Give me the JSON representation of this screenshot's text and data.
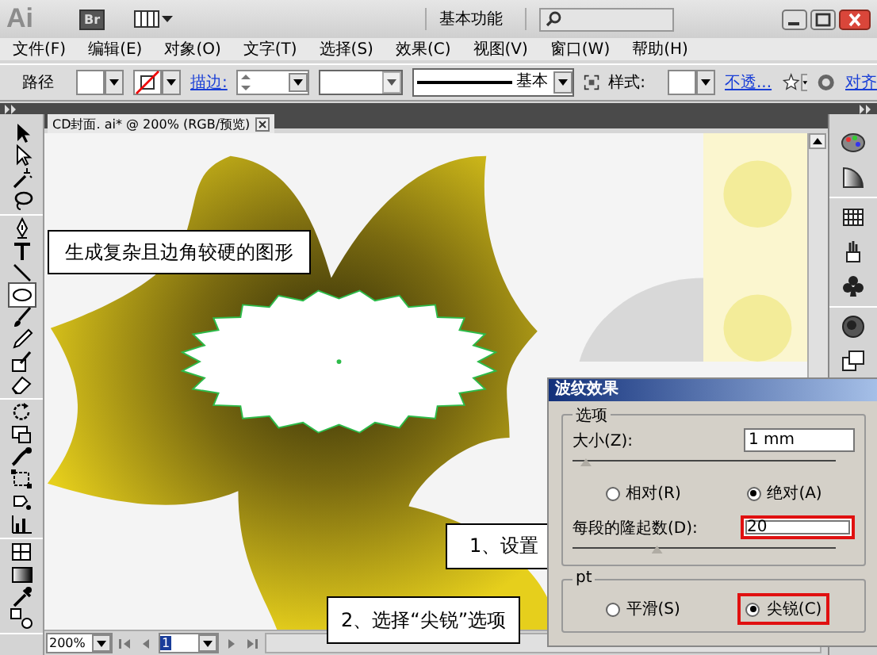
{
  "title_bar": {
    "logo": "Ai",
    "bridge": "Br",
    "workspace": "基本功能"
  },
  "menu": [
    {
      "label": "文件(F)"
    },
    {
      "label": "编辑(E)"
    },
    {
      "label": "对象(O)"
    },
    {
      "label": "文字(T)"
    },
    {
      "label": "选择(S)"
    },
    {
      "label": "效果(C)"
    },
    {
      "label": "视图(V)"
    },
    {
      "label": "窗口(W)"
    },
    {
      "label": "帮助(H)"
    }
  ],
  "control_bar": {
    "selection_label": "路径",
    "stroke_link": "描边:",
    "stroke_profile": "基本",
    "style_label": "样式:",
    "opacity_link": "不透...",
    "align_link": "对齐"
  },
  "document_tab": {
    "title": "CD封面. ai* @ 200% (RGB/预览)"
  },
  "tool_groups": [
    {
      "tools": [
        {
          "kind": "selection",
          "selected": false
        },
        {
          "kind": "direct",
          "selected": false
        },
        {
          "kind": "wand",
          "selected": false
        },
        {
          "kind": "lasso",
          "selected": false
        }
      ]
    },
    {
      "tools": [
        {
          "kind": "pen",
          "selected": false
        },
        {
          "kind": "type",
          "selected": false
        },
        {
          "kind": "line",
          "selected": false
        },
        {
          "kind": "ellipse",
          "selected": true
        },
        {
          "kind": "brush",
          "selected": false
        },
        {
          "kind": "pencil",
          "selected": false
        },
        {
          "kind": "blob",
          "selected": false
        },
        {
          "kind": "eraser",
          "selected": false
        }
      ]
    },
    {
      "tools": [
        {
          "kind": "rotate",
          "selected": false
        },
        {
          "kind": "scale",
          "selected": false
        },
        {
          "kind": "warp",
          "selected": false
        },
        {
          "kind": "transform",
          "selected": false
        },
        {
          "kind": "sprayer",
          "selected": false
        },
        {
          "kind": "graph",
          "selected": false
        }
      ]
    },
    {
      "tools": [
        {
          "kind": "mesh",
          "selected": false
        },
        {
          "kind": "gradient",
          "selected": false
        },
        {
          "kind": "eyedropper",
          "selected": false
        },
        {
          "kind": "blend",
          "selected": false
        }
      ]
    }
  ],
  "status_bar": {
    "zoom": "200%",
    "page": "1"
  },
  "annotations": [
    {
      "text": "生成复杂且边角较硬的图形"
    },
    {
      "text": "1、设置"
    },
    {
      "text": "2、选择“尖锐”选项"
    }
  ],
  "dialog": {
    "title": "波纹效果",
    "options_group": "选项",
    "size": {
      "label": "大小(Z):",
      "value": "1 mm",
      "level": 0.03
    },
    "mode_radios": [
      {
        "label": "相对(R)",
        "selected": false
      },
      {
        "label": "绝对(A)",
        "selected": true
      }
    ],
    "ridges": {
      "label": "每段的隆起数(D):",
      "value": "20",
      "level": 0.3,
      "highlighted": true
    },
    "points_group": "pt",
    "point_radios": [
      {
        "label": "平滑(S)",
        "selected": false
      },
      {
        "label": "尖锐(C)",
        "selected": true,
        "highlighted": true
      }
    ]
  }
}
